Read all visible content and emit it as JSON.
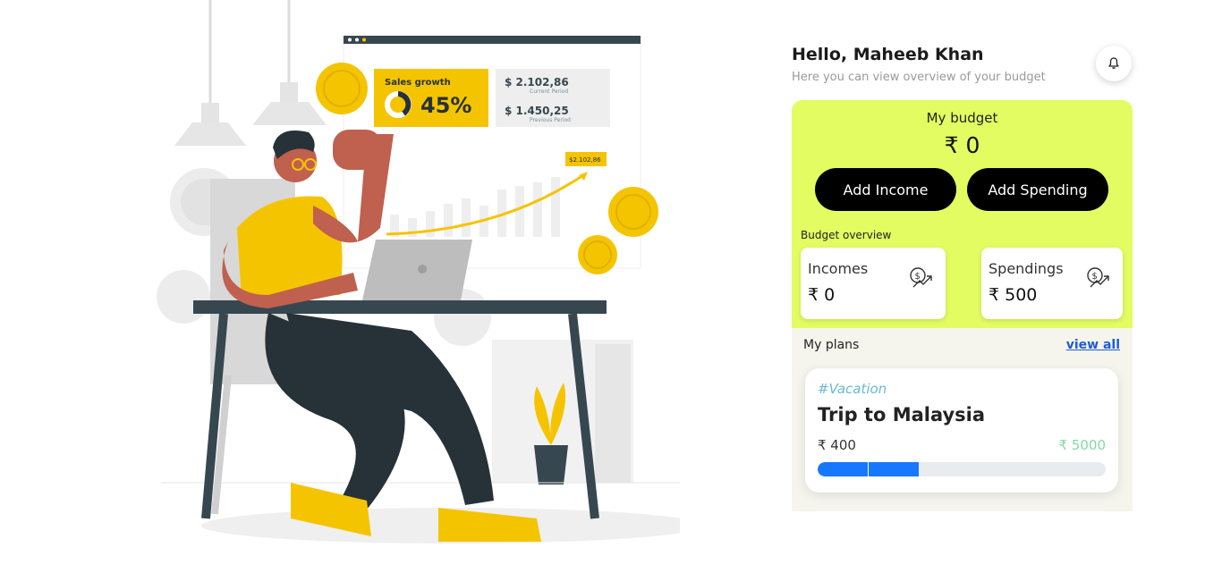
{
  "illustration": {
    "sales_growth_label": "Sales growth",
    "sales_growth_value": "45%",
    "current_amount": "$ 2.102,86",
    "current_label": "Current Period",
    "previous_amount": "$ 1.450,25",
    "previous_label": "Previous Period",
    "chart_badge": "$2.102,86"
  },
  "header": {
    "greeting": "Hello, Maheeb Khan",
    "subtitle": "Here you can view overview of your budget",
    "bell_icon": "bell-icon"
  },
  "budget": {
    "title": "My budget",
    "amount": "₹ 0",
    "add_income_label": "Add Income",
    "add_spending_label": "Add Spending",
    "overview_label": "Budget overview",
    "incomes_label": "Incomes",
    "incomes_value": "₹ 0",
    "spendings_label": "Spendings",
    "spendings_value": "₹ 500"
  },
  "plans": {
    "title": "My plans",
    "view_all_label": "view all",
    "items": [
      {
        "tag": "#Vacation",
        "name": "Trip to Malaysia",
        "current": "₹ 400",
        "target": "₹ 5000",
        "progress_fraction": 0.35
      }
    ]
  },
  "colors": {
    "accent_lime": "#e2fc62",
    "progress_blue": "#1677ff",
    "link_blue": "#1e5bd8",
    "target_green": "#86d8a5",
    "tag_blue": "#6bb8d2"
  }
}
